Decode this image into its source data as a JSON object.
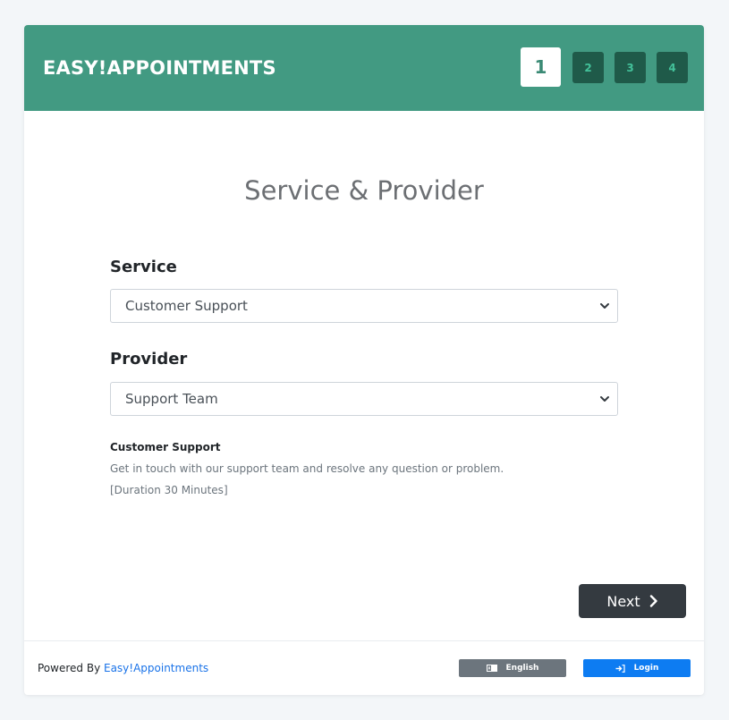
{
  "header": {
    "brand": "EASY!APPOINTMENTS",
    "steps": [
      "1",
      "2",
      "3",
      "4"
    ],
    "active_step": 1
  },
  "main": {
    "title": "Service & Provider",
    "service_label": "Service",
    "service_value": "Customer Support",
    "provider_label": "Provider",
    "provider_value": "Support Team",
    "description": {
      "name": "Customer Support",
      "text": "Get in touch with our support team and resolve any question or problem.",
      "duration": "[Duration 30 Minutes]"
    },
    "next_label": "Next"
  },
  "footer": {
    "powered_prefix": "Powered By ",
    "powered_link": "Easy!Appointments",
    "language_label": "English",
    "login_label": "Login"
  },
  "colors": {
    "header_bg": "#429a82",
    "step_inactive_bg": "#1f5a49",
    "step_inactive_text": "#43c19a",
    "next_button_bg": "#343a40",
    "language_button_bg": "#6c757d",
    "login_button_bg": "#0d7cf2",
    "link": "#1a73e8"
  },
  "icons": {
    "select_arrow": "chevron-down-icon",
    "next": "chevron-right-icon",
    "language": "language-icon",
    "login": "sign-in-icon"
  }
}
